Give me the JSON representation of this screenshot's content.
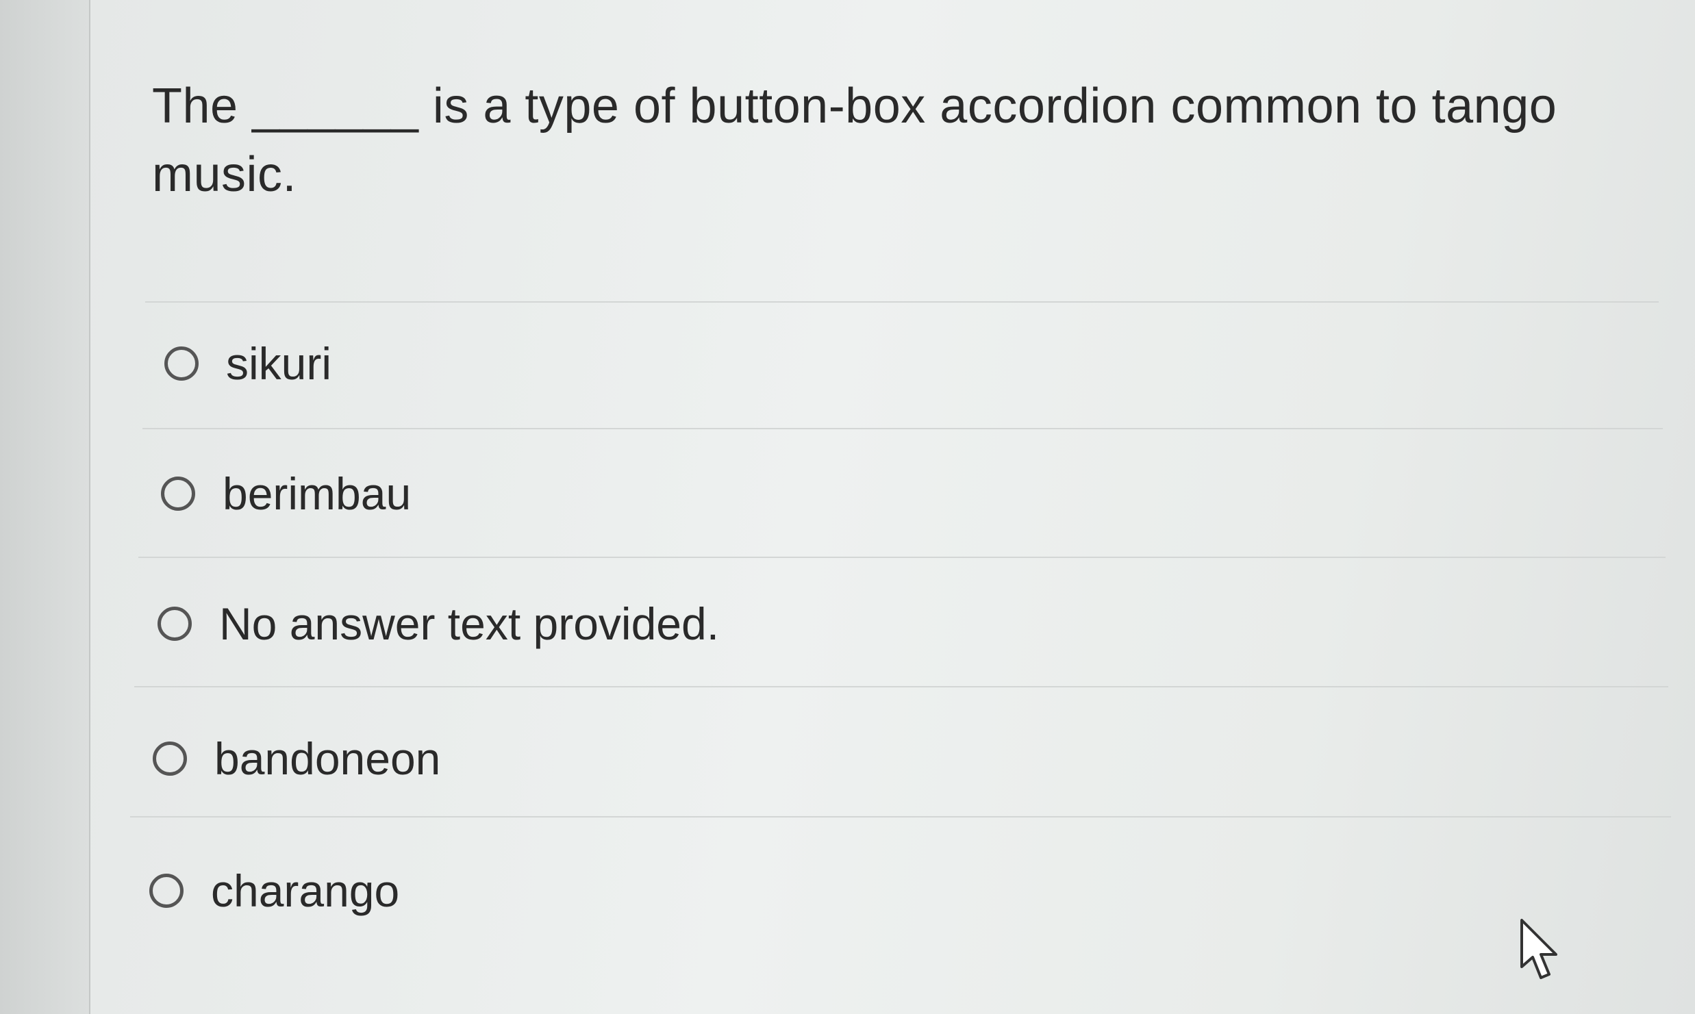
{
  "question": {
    "text": "The ______ is a type of button-box accordion common to tango music."
  },
  "options": [
    {
      "label": "sikuri",
      "selected": false
    },
    {
      "label": "berimbau",
      "selected": false
    },
    {
      "label": "No answer text provided.",
      "selected": false
    },
    {
      "label": "bandoneon",
      "selected": false
    },
    {
      "label": "charango",
      "selected": false
    }
  ],
  "icons": {
    "radio": "radio-button-icon",
    "cursor": "mouse-pointer-icon"
  },
  "colors": {
    "text": "#2a2a2a",
    "radio_border": "#555555",
    "divider": "#d3d6d5"
  }
}
